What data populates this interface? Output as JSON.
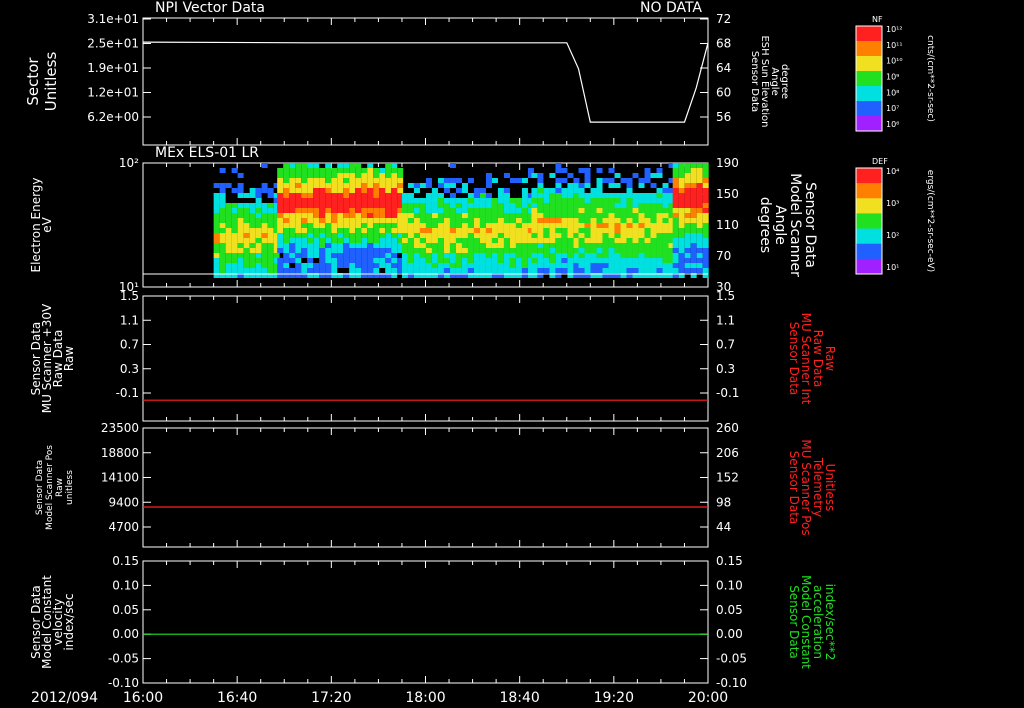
{
  "date_label": "2012/094",
  "time_ticks": [
    "16:00",
    "16:40",
    "17:20",
    "18:00",
    "18:40",
    "19:20",
    "20:00"
  ],
  "colors": {
    "background": "#000000",
    "axis": "#ffffff",
    "trace_white": "#ffffff",
    "trace_red": "#ff2020",
    "trace_green": "#20e020",
    "label_red": "#ff2020",
    "label_green": "#20e020"
  },
  "colorbars": [
    {
      "tag": "NF",
      "ticks": [
        "10¹²",
        "10¹¹",
        "10¹⁰",
        "10⁹",
        "10⁸",
        "10⁷",
        "10⁶"
      ],
      "units": "cnts/(cm**2-sr-sec)"
    },
    {
      "tag": "DEF",
      "ticks": [
        "10⁴",
        "10³",
        "10²",
        "10¹"
      ],
      "units": "ergs/(cm**2-sr-sec-eV)"
    }
  ],
  "chart_data": [
    {
      "type": "line",
      "title": "NPI Vector Data",
      "status": "NO DATA",
      "left_axis": {
        "label_lines": [
          "Sector",
          "Unitless"
        ],
        "ticks": [
          "3.1e+01",
          "2.5e+01",
          "1.9e+01",
          "1.2e+01",
          "6.2e+00"
        ]
      },
      "right_axis": {
        "label_lines": [
          "Sensor Data",
          "ESH Sun Elevation",
          "Angle",
          "degree"
        ],
        "ticks": [
          "72",
          "68",
          "64",
          "60",
          "56"
        ],
        "range": [
          52,
          72
        ]
      },
      "series": [
        {
          "axis": "right",
          "x": [
            "16:00",
            "17:10",
            "19:00",
            "19:05",
            "19:10",
            "19:50",
            "19:55",
            "20:00"
          ],
          "values": [
            68.2,
            68.1,
            68.1,
            64,
            55.6,
            55.6,
            61,
            68.1
          ]
        }
      ]
    },
    {
      "type": "heatmap",
      "title": "MEx ELS-01 LR",
      "left_axis": {
        "label_lines": [
          "Electron Energy",
          "eV"
        ],
        "ticks": [
          "10²",
          "10¹"
        ],
        "scale": "log"
      },
      "right_axis": {
        "label_lines": [
          "Sensor Data",
          "Model Scanner",
          "Angle",
          "degrees"
        ],
        "ticks": [
          "190",
          "150",
          "110",
          "70",
          "30"
        ]
      },
      "data_start": "16:30",
      "segments": [
        {
          "from": "16:30",
          "to": "16:57",
          "peak_energy_eV": 12,
          "intensity": "medium"
        },
        {
          "from": "16:57",
          "to": "17:50",
          "peak_energy_eV": 50,
          "intensity": "high"
        },
        {
          "from": "17:50",
          "to": "18:45",
          "peak_energy_eV": 15,
          "intensity": "medium"
        },
        {
          "from": "18:45",
          "to": "19:05",
          "peak_energy_eV": 20,
          "intensity": "medium"
        },
        {
          "from": "19:05",
          "to": "19:45",
          "peak_energy_eV": 18,
          "intensity": "medium"
        },
        {
          "from": "19:45",
          "to": "20:00",
          "peak_energy_eV": 60,
          "intensity": "high"
        }
      ]
    },
    {
      "type": "line",
      "left_axis": {
        "label_lines": [
          "Sensor Data",
          "MU Scanner +30V",
          "Raw Data",
          "Raw"
        ],
        "ticks": [
          "1.5",
          "1.1",
          "0.7",
          "0.3",
          "-0.1"
        ],
        "range": [
          -0.3,
          1.5
        ]
      },
      "right_axis": {
        "label_lines": [
          "Sensor Data",
          "MU Scanner Int",
          "Raw Data",
          "Raw"
        ],
        "ticks": [
          "1.5",
          "1.1",
          "0.7",
          "0.3",
          "-0.1"
        ],
        "color": "#ff2020"
      },
      "series": [
        {
          "color": "#ff2020",
          "x": [
            "16:00",
            "20:00"
          ],
          "values": [
            0.0,
            0.0
          ]
        }
      ]
    },
    {
      "type": "line",
      "left_axis": {
        "label_lines": [
          "Sensor Data",
          "Model Scanner Pos",
          "Raw",
          "unitless"
        ],
        "ticks": [
          "23500",
          "18800",
          "14100",
          "9400",
          "4700"
        ],
        "range": [
          0,
          23500
        ]
      },
      "right_axis": {
        "label_lines": [
          "Sensor Data",
          "MU Scanner Pos",
          "Telemetry",
          "Unitless"
        ],
        "ticks": [
          "260",
          "206",
          "152",
          "98",
          "44"
        ],
        "color": "#ff2020"
      },
      "series": [
        {
          "color": "#ff2020",
          "x": [
            "16:00",
            "20:00"
          ],
          "values": [
            7900,
            7900
          ]
        }
      ]
    },
    {
      "type": "line",
      "left_axis": {
        "label_lines": [
          "Sensor Data",
          "Model Constant",
          "velocity",
          "index/sec"
        ],
        "ticks": [
          "0.15",
          "0.10",
          "0.05",
          "0.00",
          "-0.05",
          "-0.10"
        ],
        "range": [
          -0.1,
          0.15
        ]
      },
      "right_axis": {
        "label_lines": [
          "Sensor Data",
          "Model Constant",
          "acceleration",
          "index/sec**2"
        ],
        "ticks": [
          "0.15",
          "0.10",
          "0.05",
          "0.00",
          "-0.05",
          "-0.10"
        ],
        "color": "#20e020"
      },
      "series": [
        {
          "color": "#20e020",
          "x": [
            "16:00",
            "20:00"
          ],
          "values": [
            0.0,
            0.0
          ]
        }
      ]
    }
  ]
}
